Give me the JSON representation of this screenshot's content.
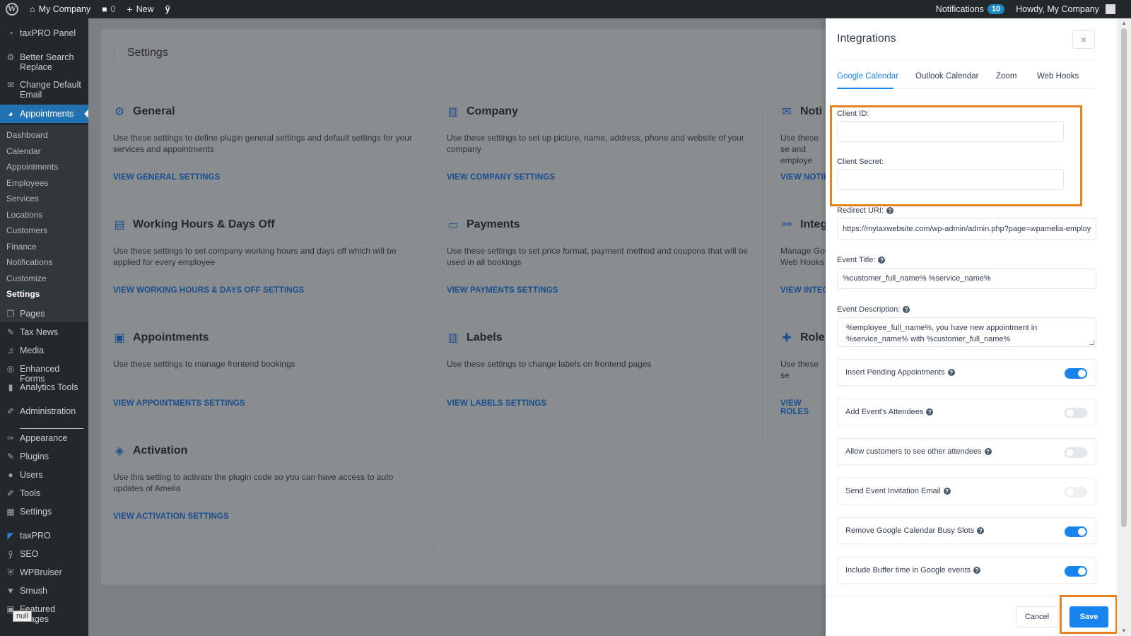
{
  "adminbar": {
    "site_name": "My Company",
    "comments_count": "0",
    "new_label": "New",
    "notifications_label": "Notifications",
    "notifications_count": "10",
    "howdy": "Howdy, My Company"
  },
  "sidebar": {
    "top_items": [
      {
        "label": "taxPRO Panel",
        "icon": "panel-icon"
      },
      {
        "label": "Better Search Replace",
        "icon": "gear-icon"
      },
      {
        "label": "Change Default Email",
        "icon": "envelope-icon"
      },
      {
        "label": "Appointments",
        "icon": "appointments-icon"
      }
    ],
    "sub_items": [
      "Dashboard",
      "Calendar",
      "Appointments",
      "Employees",
      "Services",
      "Locations",
      "Customers",
      "Finance",
      "Notifications",
      "Customize",
      "Settings"
    ],
    "bottom_items": [
      {
        "label": "Pages",
        "icon": "pages-icon"
      },
      {
        "label": "Tax News",
        "icon": "pin-icon"
      },
      {
        "label": "Media",
        "icon": "media-icon"
      },
      {
        "label": "Enhanced Forms",
        "icon": "forms-icon"
      },
      {
        "label": "Analytics Tools",
        "icon": "chart-icon"
      },
      {
        "label": "Administration",
        "icon": "wrench-icon"
      },
      {
        "label": "Appearance",
        "icon": "brush-icon"
      },
      {
        "label": "Plugins",
        "icon": "plug-icon"
      },
      {
        "label": "Users",
        "icon": "user-icon"
      },
      {
        "label": "Tools",
        "icon": "wrench-icon"
      },
      {
        "label": "Settings",
        "icon": "settings-icon"
      },
      {
        "label": "taxPRO",
        "icon": "taxpro-icon"
      },
      {
        "label": "SEO",
        "icon": "seo-icon"
      },
      {
        "label": "WPBruiser",
        "icon": "shield-icon"
      },
      {
        "label": "Smush",
        "icon": "smush-icon"
      },
      {
        "label": "Featured Images",
        "icon": "image-icon"
      }
    ],
    "tooltip": "null"
  },
  "settings": {
    "title": "Settings",
    "blocks": [
      {
        "title": "General",
        "desc": "Use these settings to define plugin general settings and default settings for your services and appointments",
        "link": "VIEW GENERAL SETTINGS",
        "icon": "gear-icon"
      },
      {
        "title": "Company",
        "desc": "Use these settings to set up picture, name, address, phone and website of your company",
        "link": "VIEW COMPANY SETTINGS",
        "icon": "building-icon"
      },
      {
        "title": "Noti",
        "desc": "Use these se and employe",
        "link": "VIEW NOTIF",
        "icon": "envelope-icon"
      },
      {
        "title": "Working Hours & Days Off",
        "desc": "Use these settings to set company working hours and days off which will be applied for every employee",
        "link": "VIEW WORKING HOURS & DAYS OFF SETTINGS",
        "icon": "calendar-icon"
      },
      {
        "title": "Payments",
        "desc": "Use these settings to set price format, payment method and coupons that will be used in all bookings",
        "link": "VIEW PAYMENTS SETTINGS",
        "icon": "card-icon"
      },
      {
        "title": "Integ",
        "desc": "Manage Goo Web Hooks",
        "link": "VIEW INTEG",
        "icon": "link-icon"
      },
      {
        "title": "Appointments",
        "desc": "Use these settings to manage frontend bookings",
        "link": "VIEW APPOINTMENTS SETTINGS",
        "icon": "appointment-icon"
      },
      {
        "title": "Labels",
        "desc": "Use these settings to change labels on frontend pages",
        "link": "VIEW LABELS SETTINGS",
        "icon": "labels-icon"
      },
      {
        "title": "Role",
        "desc": "Use these se",
        "link": "VIEW ROLES",
        "icon": "puzzle-icon"
      },
      {
        "title": "Activation",
        "desc": "Use this setting to activate the plugin code so you can have access to auto updates of Amelia",
        "link": "VIEW ACTIVATION SETTINGS",
        "icon": "tag-icon"
      }
    ]
  },
  "panel": {
    "title": "Integrations",
    "tabs": [
      "Google Calendar",
      "Outlook Calendar",
      "Zoom",
      "Web Hooks"
    ],
    "client_id_label": "Client ID:",
    "client_id_value": "",
    "client_secret_label": "Client Secret:",
    "client_secret_value": "",
    "redirect_label": "Redirect URI:",
    "redirect_value": "https://mytaxwebsite.com/wp-admin/admin.php?page=wpamelia-employ",
    "event_title_label": "Event Title:",
    "event_title_value": "%customer_full_name% %service_name%",
    "event_desc_label": "Event Description:",
    "event_desc_value": "%employee_full_name%, you have new appointment in %service_name% with %customer_full_name%",
    "toggles": [
      {
        "label": "Insert Pending Appointments",
        "on": true
      },
      {
        "label": "Add Event's Attendees",
        "on": false
      },
      {
        "label": "Allow customers to see other attendees",
        "on": false
      },
      {
        "label": "Send Event Invitation Email",
        "on": false
      },
      {
        "label": "Remove Google Calendar Busy Slots",
        "on": true
      },
      {
        "label": "Include Buffer time in Google events",
        "on": true
      }
    ],
    "cancel_label": "Cancel",
    "save_label": "Save",
    "highlight_color": "#e8811f",
    "accent_color": "#1a84ee"
  }
}
